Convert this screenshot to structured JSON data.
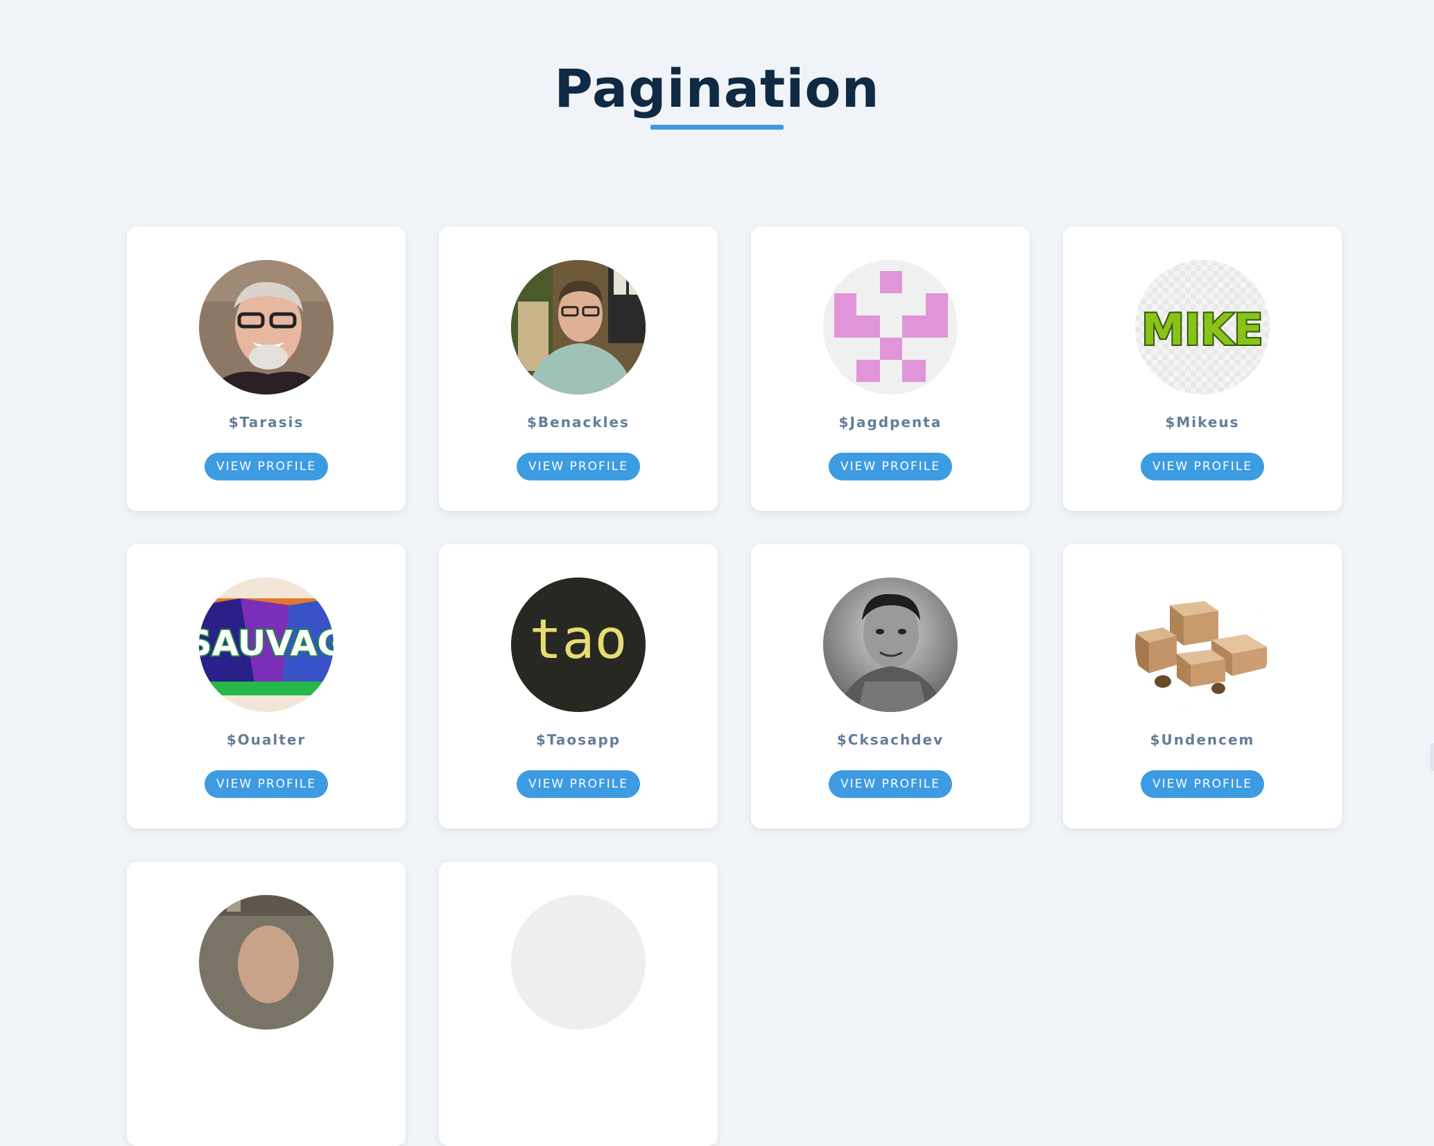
{
  "page": {
    "title": "Pagination"
  },
  "profiles": [
    {
      "username": "$Tarasis",
      "button_label": "VIEW PROFILE",
      "avatar": "portrait-smiling-man-glasses-icon"
    },
    {
      "username": "$Benackles",
      "button_label": "VIEW PROFILE",
      "avatar": "portrait-man-office-icon"
    },
    {
      "username": "$Jagdpenta",
      "button_label": "VIEW PROFILE",
      "avatar": "pink-identicon-icon"
    },
    {
      "username": "$Mikeus",
      "button_label": "VIEW PROFILE",
      "avatar": "mike-text-logo-icon"
    },
    {
      "username": "$Oualter",
      "button_label": "VIEW PROFILE",
      "avatar": "sauvag-graffiti-icon"
    },
    {
      "username": "$Taosapp",
      "button_label": "VIEW PROFILE",
      "avatar": "tao-text-logo-icon"
    },
    {
      "username": "$Cksachdev",
      "button_label": "VIEW PROFILE",
      "avatar": "portrait-man-grayscale-icon"
    },
    {
      "username": "$Undencem",
      "button_label": "VIEW PROFILE",
      "avatar": "cardboard-boxes-icon"
    },
    {
      "username": "",
      "button_label": "",
      "avatar": "portrait-partial-icon"
    },
    {
      "username": "",
      "button_label": "",
      "avatar": "blank-avatar-icon"
    }
  ],
  "avatar_text": {
    "mike": "MIKE",
    "sauvag": "SAUVAG",
    "tao": "tao"
  },
  "colors": {
    "background": "#f0f4f8",
    "title": "#102a43",
    "accent": "#3d9be2",
    "username": "#627d98",
    "card": "#ffffff"
  }
}
